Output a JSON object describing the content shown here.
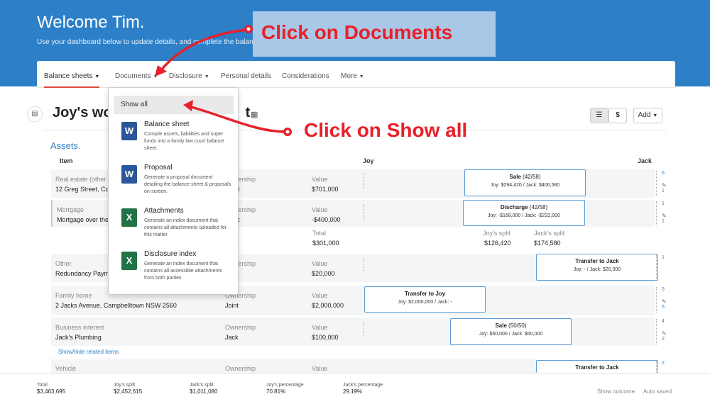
{
  "header": {
    "welcome": "Welcome Tim.",
    "subtitle": "Use your dashboard below to update details, and complete the balance sheet and"
  },
  "nav": {
    "tabs": [
      {
        "label": "Balance sheets"
      },
      {
        "label": "Documents"
      },
      {
        "label": "Disclosure"
      },
      {
        "label": "Personal details"
      },
      {
        "label": "Considerations"
      },
      {
        "label": "More"
      }
    ]
  },
  "dropdown": {
    "show_all": "Show all",
    "items": [
      {
        "title": "Balance sheet",
        "desc": "Compile assets, liabilities and super funds into a family law court balance sheet.",
        "icon": "word-icon"
      },
      {
        "title": "Proposal",
        "desc": "Generate a proposal document detailing the balance sheet & proposals on-screen.",
        "icon": "word-icon"
      },
      {
        "title": "Attachments",
        "desc": "Generate an index document that contains all attachments uploaded for this matter.",
        "icon": "excel-icon"
      },
      {
        "title": "Disclosure index",
        "desc": "Generate an index document that contains all accessible attachments from both parties.",
        "icon": "excel-icon"
      }
    ]
  },
  "page": {
    "title": "Joy's wo",
    "title_tail": "t",
    "add_label": "Add",
    "dollar_label": "$"
  },
  "assets": {
    "section": "Assets.",
    "col_item": "Item",
    "col_joy": "Joy",
    "col_jack": "Jack",
    "ownership_label": "Ownership",
    "value_label": "Value",
    "rows": [
      {
        "category": "Real estate (other",
        "name": "12 Greg Street, Coo",
        "ownership": "t",
        "value": "$701,000",
        "box_title": "Sale",
        "box_note": "(42/58)",
        "box_detail": "Joy: $294,420 / Jack: $406,580",
        "count1": "6",
        "count2": "1"
      },
      {
        "category": "Mortgage",
        "name": "Mortgage over the",
        "ownership": "t",
        "value": "-$400,000",
        "box_title": "Discharge",
        "box_note": "(42/58)",
        "box_detail": "Joy: -$168,000 / Jack: -$232,000",
        "count1": "1",
        "count2": "1"
      },
      {
        "category": "Other",
        "name": "Redundancy Paym",
        "ownership": "",
        "value": "$20,000",
        "box_title": "Transfer to Jack",
        "box_note": "",
        "box_detail": "Joy: - / Jack: $20,000",
        "count1": "1",
        "count2": ""
      },
      {
        "category": "Family home",
        "name": "2 Jacks Avenue, Campbelltown NSW 2560",
        "ownership": "Joint",
        "value": "$2,000,000",
        "box_title": "Transfer to Joy",
        "box_note": "",
        "box_detail": "Joy: $2,000,000 / Jack: -",
        "count1": "5",
        "count2": "5"
      },
      {
        "category": "Business interest",
        "name": "Jack's Plumbing",
        "ownership": "Jack",
        "value": "$100,000",
        "box_title": "Sale",
        "box_note": "(50/50)",
        "box_detail": "Joy: $50,000 / Jack: $50,000",
        "count1": "4",
        "count2": "2"
      },
      {
        "category": "Vehicle",
        "name": "",
        "ownership": "",
        "value": "",
        "box_title": "Transfer to Jack",
        "box_note": "",
        "box_detail": "",
        "count1": "2",
        "count2": ""
      }
    ],
    "subtotal": {
      "total_label": "Total",
      "total": "$301,000",
      "joy_label": "Joy's split",
      "joy": "$126,420",
      "jack_label": "Jack's split",
      "jack": "$174,580"
    },
    "related_link": "Show/hide related items"
  },
  "footer": {
    "items": [
      {
        "label": "Total",
        "value": "$3,463,695"
      },
      {
        "label": "Joy's split",
        "value": "$2,452,615"
      },
      {
        "label": "Jack's split",
        "value": "$1,011,080"
      },
      {
        "label": "Joy's percentage",
        "value": "70.81%"
      },
      {
        "label": "Jack's percentage",
        "value": "29.19%"
      }
    ],
    "show_outcome": "Show outcome.",
    "auto_saved": "Auto saved."
  },
  "annotations": {
    "click_documents": "Click on Documents",
    "click_show_all": "Click on Show all",
    "color": "#e8202a"
  },
  "colors": {
    "brand": "#2d80c8",
    "active_tab": "#e0473c",
    "box_border": "#5b9bd5"
  }
}
